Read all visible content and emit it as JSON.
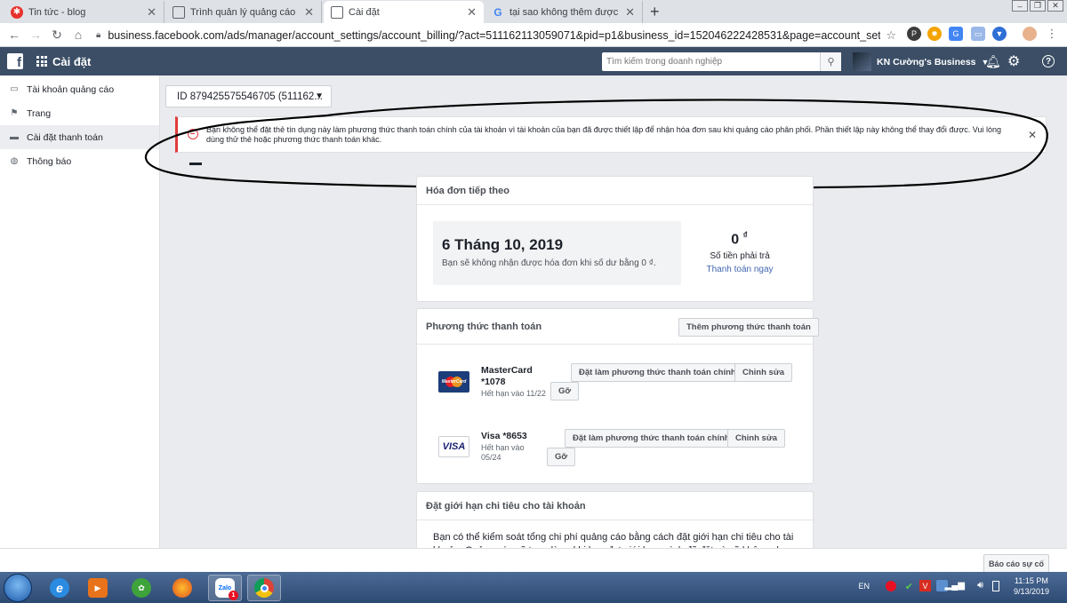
{
  "browser": {
    "tabs": [
      {
        "title": "Tin tức - blog",
        "icon": "blog-favicon-icon"
      },
      {
        "title": "Trình quản lý quảng cáo",
        "icon": "page-favicon-icon"
      },
      {
        "title": "Cài đặt",
        "icon": "page-favicon-icon",
        "active": true
      },
      {
        "title": "tại sao không thêm được phương",
        "icon": "google-favicon-icon"
      }
    ],
    "new_tab": "+",
    "url": "business.facebook.com/ads/manager/account_settings/account_billing/?act=511162113059071&pid=p1&business_id=152046222428531&page=account_settings&tab=account_billi..."
  },
  "fb": {
    "title": "Cài đặt",
    "search_placeholder": "Tìm kiếm trong doanh nghiệp",
    "business_name": "KN Cường's Business",
    "brand_color": "#3b4e66"
  },
  "sidebar": {
    "items": [
      {
        "label": "Tài khoản quảng cáo",
        "icon": "ad-account-icon"
      },
      {
        "label": "Trang",
        "icon": "flag-icon"
      },
      {
        "label": "Cài đặt thanh toán",
        "icon": "credit-card-icon",
        "active": true
      },
      {
        "label": "Thông báo",
        "icon": "globe-icon"
      }
    ]
  },
  "account_selector": {
    "label": "ID 879425575546705 (511162..."
  },
  "alert": {
    "message": "Bạn không thể đặt thẻ tín dụng này làm phương thức thanh toán chính của tài khoản vì tài khoản của bạn đã được thiết lập để nhận hóa đơn sau khi quảng cáo phân phối. Phần thiết lập này không thể thay đổi được. Vui lòng dùng thử thẻ hoặc phương thức thanh toán khác.",
    "accent": "#e03b3b"
  },
  "next_bill": {
    "title": "Hóa đơn tiếp theo",
    "date": "6 Tháng 10, 2019",
    "note": "Bạn sẽ không nhận được hóa đơn khi số dư bằng 0 ₫.",
    "amount": "0",
    "currency": "₫",
    "amount_label": "Số tiền phải trả",
    "pay_now": "Thanh toán ngay"
  },
  "payment_methods": {
    "title": "Phương thức thanh toán",
    "add_button": "Thêm phương thức thanh toán",
    "items": [
      {
        "brand": "MasterCard",
        "name_line1": "MasterCard",
        "name_line2": "*1078",
        "expiry": "Hết hạn vào 11/22",
        "set_primary": "Đặt làm phương thức thanh toán chính",
        "edit": "Chỉnh sửa",
        "remove": "Gỡ"
      },
      {
        "brand": "VISA",
        "name_line1": "Visa *8653",
        "expiry_line1": "Hết hạn vào",
        "expiry_line2": "05/24",
        "set_primary": "Đặt làm phương thức thanh toán chính",
        "edit": "Chỉnh sửa",
        "remove": "Gỡ"
      }
    ]
  },
  "spend_limit": {
    "title": "Đặt giới hạn chi tiêu cho tài khoản",
    "text": "Bạn có thể kiểm soát tổng chi phí quảng cáo bằng cách đặt giới hạn chi tiêu cho tài khoản. Quảng cáo sẽ tạm dừng khi bạn đạt giới hạn mình đã đặt và sẽ không chạy lại"
  },
  "report_button": "Báo cáo sự cố",
  "taskbar": {
    "lang": "EN",
    "time": "11:15 PM",
    "date": "9/13/2019",
    "zalo_badge": "1",
    "zalo_label": "Zalo"
  }
}
